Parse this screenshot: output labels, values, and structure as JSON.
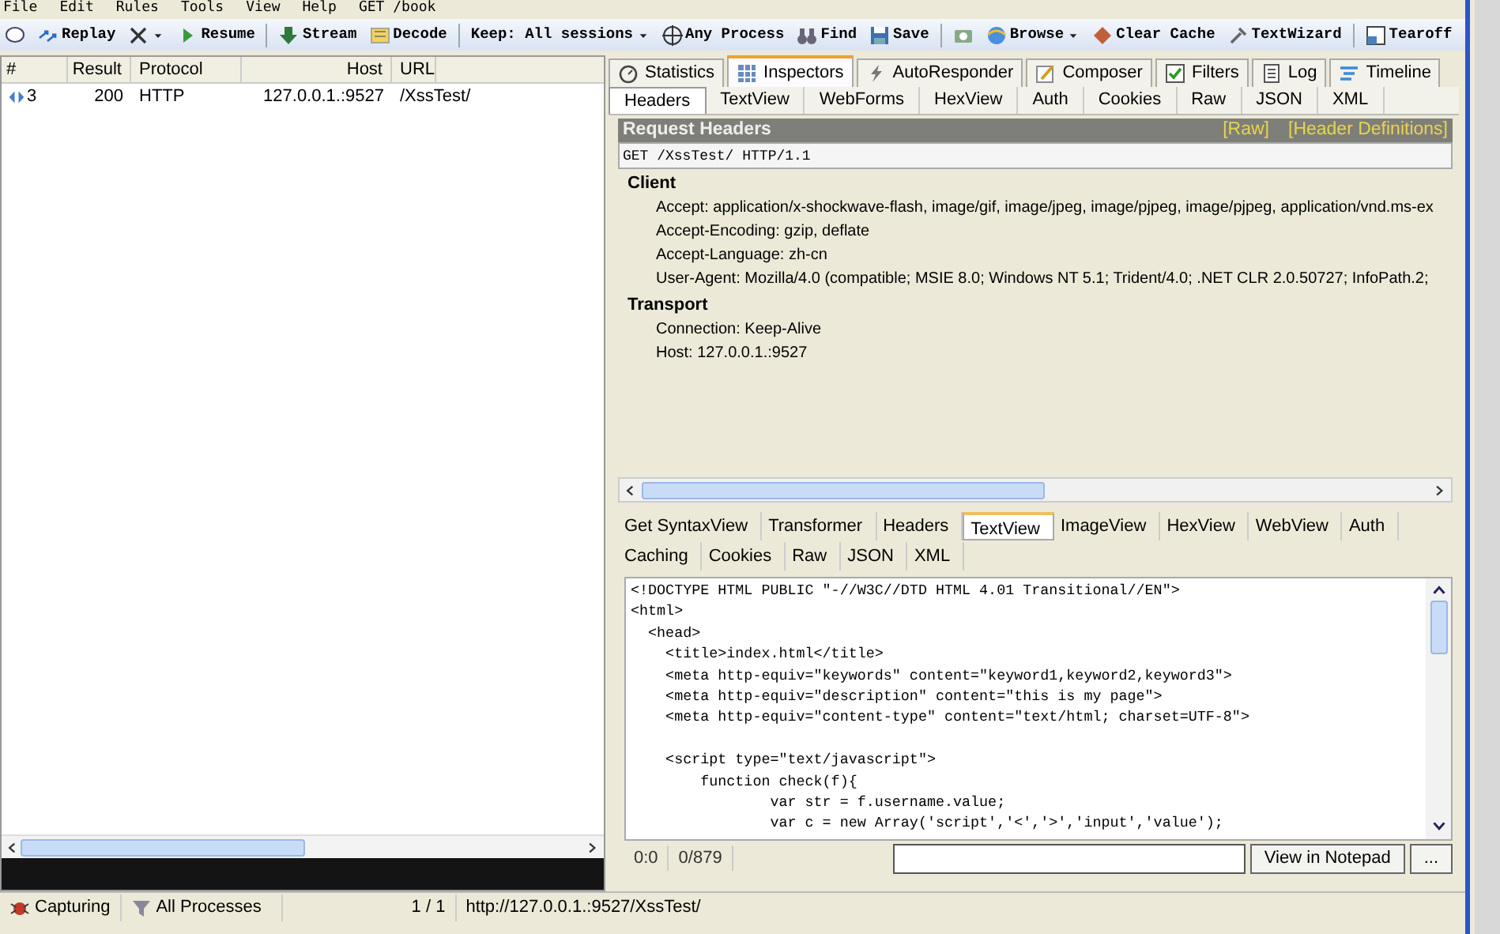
{
  "menu": [
    "File",
    "Edit",
    "Rules",
    "Tools",
    "View",
    "Help",
    "GET /book"
  ],
  "toolbar": [
    {
      "dropdown": false
    },
    {
      "label": "Replay",
      "dropdown": false
    },
    {
      "dropdown": true
    },
    {
      "label": "Resume",
      "dropdown": false
    },
    {
      "label": "Stream",
      "dropdown": false
    },
    {
      "label": "Decode",
      "dropdown": false
    },
    {
      "label": "Keep: All sessions",
      "dropdown": true
    },
    {
      "label": "Any Process",
      "dropdown": false
    },
    {
      "label": "Find",
      "dropdown": false
    },
    {
      "label": "Save",
      "dropdown": false
    },
    {
      "dropdown": false
    },
    {
      "label": "Browse",
      "dropdown": true
    },
    {
      "label": "Clear Cache",
      "dropdown": false
    },
    {
      "label": "TextWizard",
      "dropdown": false
    },
    {
      "label": "Tearoff",
      "dropdown": false
    }
  ],
  "sessions": {
    "columns": [
      "#",
      "Result",
      "Protocol",
      "Host",
      "URL"
    ],
    "rows": [
      {
        "num": "3",
        "result": "200",
        "protocol": "HTTP",
        "host": "127.0.0.1.:9527",
        "url": "/XssTest/"
      }
    ]
  },
  "main_tabs": [
    {
      "label": "Statistics",
      "selected": false
    },
    {
      "label": "Inspectors",
      "selected": true
    },
    {
      "label": "AutoResponder",
      "selected": false
    },
    {
      "label": "Composer",
      "selected": false
    },
    {
      "label": "Filters",
      "selected": false
    },
    {
      "label": "Log",
      "selected": false
    },
    {
      "label": "Timeline",
      "selected": false
    }
  ],
  "request_tabs": [
    {
      "label": "Headers",
      "selected": true
    },
    {
      "label": "TextView",
      "selected": false
    },
    {
      "label": "WebForms",
      "selected": false
    },
    {
      "label": "HexView",
      "selected": false
    },
    {
      "label": "Auth",
      "selected": false
    },
    {
      "label": "Cookies",
      "selected": false
    },
    {
      "label": "Raw",
      "selected": false
    },
    {
      "label": "JSON",
      "selected": false
    },
    {
      "label": "XML",
      "selected": false
    }
  ],
  "request_headers": {
    "title": "Request Headers",
    "links": [
      "[Raw]",
      "[Header Definitions]"
    ],
    "request_line": "GET /XssTest/ HTTP/1.1",
    "groups": [
      {
        "name": "Client",
        "headers": [
          "Accept: application/x-shockwave-flash, image/gif, image/jpeg, image/pjpeg, image/pjpeg, application/vnd.ms-ex",
          "Accept-Encoding: gzip, deflate",
          "Accept-Language: zh-cn",
          "User-Agent: Mozilla/4.0 (compatible; MSIE 8.0; Windows NT 5.1; Trident/4.0; .NET CLR 2.0.50727; InfoPath.2;"
        ]
      },
      {
        "name": "Transport",
        "headers": [
          "Connection: Keep-Alive",
          "Host: 127.0.0.1.:9527"
        ]
      }
    ]
  },
  "response_tabs": [
    [
      {
        "label": "Get SyntaxView",
        "selected": false
      },
      {
        "label": "Transformer",
        "selected": false
      },
      {
        "label": "Headers",
        "selected": false
      },
      {
        "label": "TextView",
        "selected": true
      },
      {
        "label": "ImageView",
        "selected": false
      },
      {
        "label": "HexView",
        "selected": false
      },
      {
        "label": "WebView",
        "selected": false
      },
      {
        "label": "Auth",
        "selected": false
      }
    ],
    [
      {
        "label": "Caching",
        "selected": false
      },
      {
        "label": "Cookies",
        "selected": false
      },
      {
        "label": "Raw",
        "selected": false
      },
      {
        "label": "JSON",
        "selected": false
      },
      {
        "label": "XML",
        "selected": false
      }
    ]
  ],
  "response_body": [
    [
      "<!DOCTYPE HTML PUBLIC \"-//W3C//DTD HTML 4.01 Transitional//EN\">",
      "<html>",
      "  <head>",
      "    <title>index.html</title>",
      "    <meta http-equiv=\"keywords\" content=\"keyword1,keyword2,keyword3\">",
      "    <meta http-equiv=\"description\" content=\"this is my page\">",
      "    <meta http-equiv=\"content-type\" content=\"text/html; charset=UTF-8\">"
    ],
    [
      "    <script type=\"text/javascript\">",
      "        function check(f){",
      "                var str = f.username.value;",
      "                var c = new Array('script','<','>','input','value');"
    ]
  ],
  "response_footer": {
    "position": "0:0",
    "size": "0/879",
    "button": "View in Notepad",
    "more": "..."
  },
  "status_bar": {
    "capture": "Capturing",
    "filter": "All Processes",
    "count": "1 / 1",
    "url": "http://127.0.0.1.:9527/XssTest/"
  }
}
